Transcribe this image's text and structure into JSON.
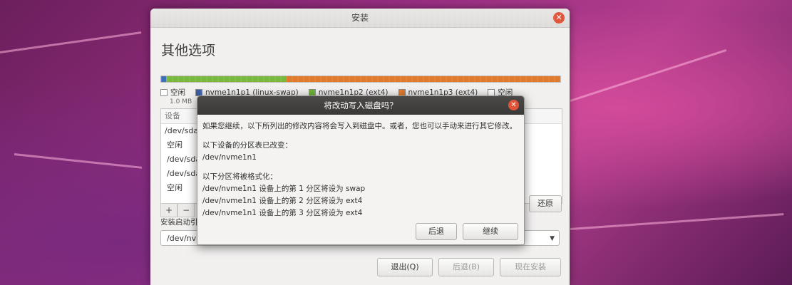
{
  "window": {
    "title": "安装",
    "heading": "其他选项"
  },
  "partition_bar": {
    "segments": [
      {
        "name": "free",
        "color": "#3f6fb8",
        "fraction": 0.012
      },
      {
        "name": "nvme1n1p1",
        "color": "#78b83c",
        "fraction": 0.3
      },
      {
        "name": "nvme1n1p3",
        "color": "#e07a2c",
        "fraction": 0.688
      }
    ]
  },
  "legend": {
    "items": [
      {
        "label": "空闲",
        "color": "#ffffff"
      },
      {
        "label": "nvme1n1p1 (linux-swap)",
        "color": "#3a5fa8"
      },
      {
        "label": "nvme1n1p2 (ext4)",
        "color": "#6cb336"
      },
      {
        "label": "nvme1n1p3 (ext4)",
        "color": "#e07a2c"
      },
      {
        "label": "空闲",
        "color": "#ffffff"
      }
    ],
    "free_size": "1.0 MB"
  },
  "device_table": {
    "header": "设备",
    "rows": [
      "/dev/sda",
      "空闲",
      "/dev/sda",
      "/dev/sda",
      "空闲"
    ]
  },
  "table_tools": [
    "+",
    "−"
  ],
  "revert_label": "还原",
  "boot_loader": {
    "label": "安装启动引",
    "value": "/dev/nvme"
  },
  "footer": {
    "quit_label": "退出(Q)",
    "back_label": "后退(B)",
    "install_label": "现在安装"
  },
  "dialog": {
    "title": "将改动写入磁盘吗？",
    "intro": "如果您继续，以下所列出的修改内容将会写入到磁盘中。或者，您也可以手动来进行其它修改。",
    "section1_title": "以下设备的分区表已改变：",
    "section1_items": [
      "/dev/nvme1n1"
    ],
    "section2_title": "以下分区将被格式化：",
    "section2_items": [
      "/dev/nvme1n1 设备上的第 1 分区将设为 swap",
      "/dev/nvme1n1 设备上的第 2 分区将设为 ext4",
      "/dev/nvme1n1 设备上的第 3 分区将设为 ext4"
    ],
    "back_label": "后退",
    "continue_label": "继续"
  }
}
